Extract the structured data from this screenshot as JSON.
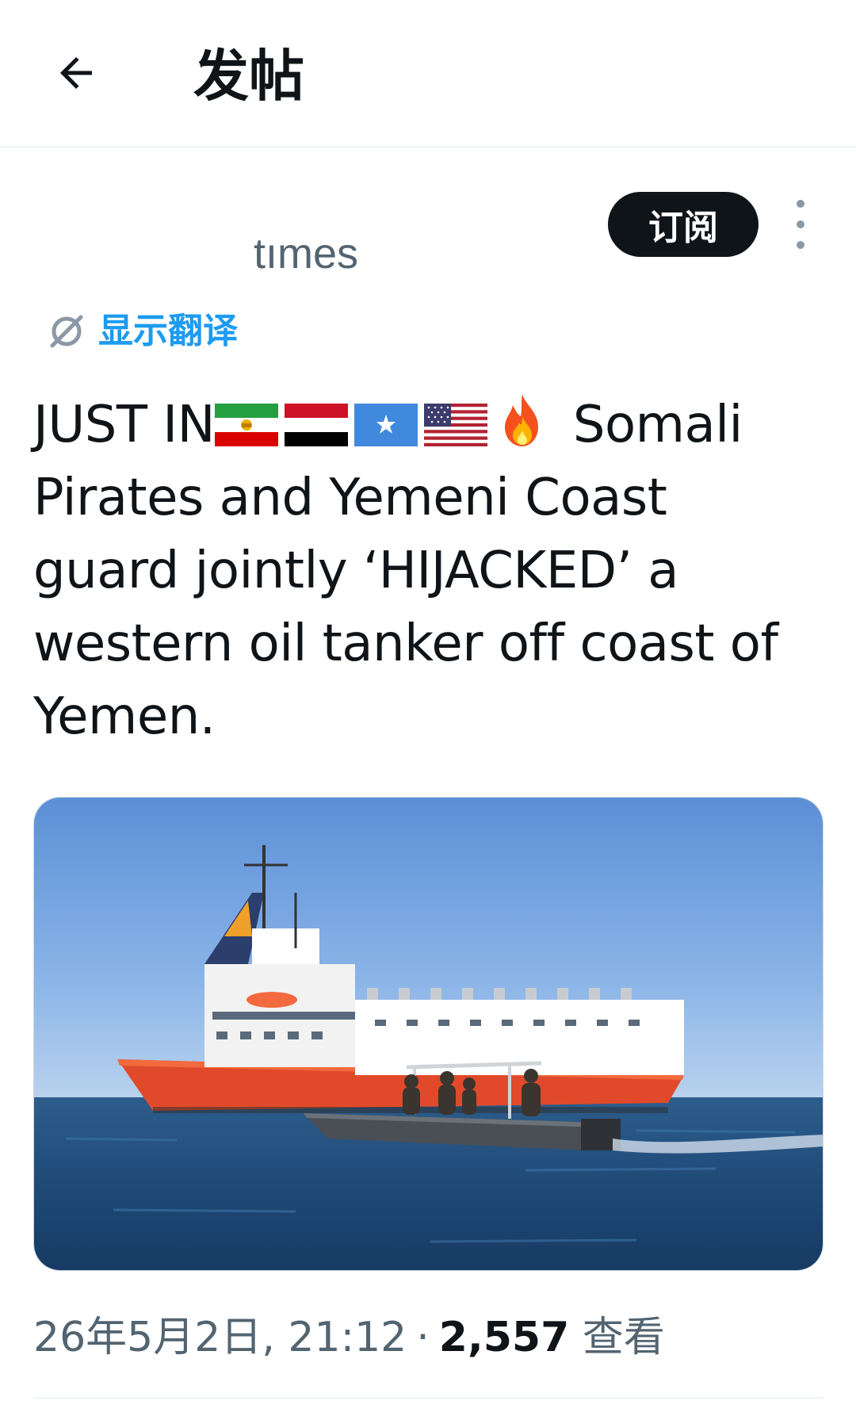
{
  "header": {
    "back_icon": "arrow-left-icon",
    "title": "发帖"
  },
  "author": {
    "name_visible_suffix": "tımes",
    "subscribe_label": "订阅",
    "more_icon": "more-vertical-icon"
  },
  "translate": {
    "icon": "translate-icon",
    "label": "显示翻译"
  },
  "post": {
    "lead": "JUST IN",
    "flags": [
      "iran-lion-sun-flag",
      "yemen-flag",
      "somalia-flag",
      "usa-flag"
    ],
    "emoji": "fire-emoji",
    "body": "Somali Pirates and Yemeni Coast guard jointly ‘HIJACKED’ a western oil tanker off coast of Yemen."
  },
  "media": {
    "description_icon": "photo-ship-and-boat"
  },
  "meta": {
    "datetime": "26年5月2日, 21:12",
    "separator": "·",
    "views_count": "2,557",
    "views_label": "查看"
  },
  "colors": {
    "text": "#0f1419",
    "secondary": "#536471",
    "link": "#1d9bf0",
    "button_bg": "#0f1419",
    "divider": "#eff3f4"
  }
}
